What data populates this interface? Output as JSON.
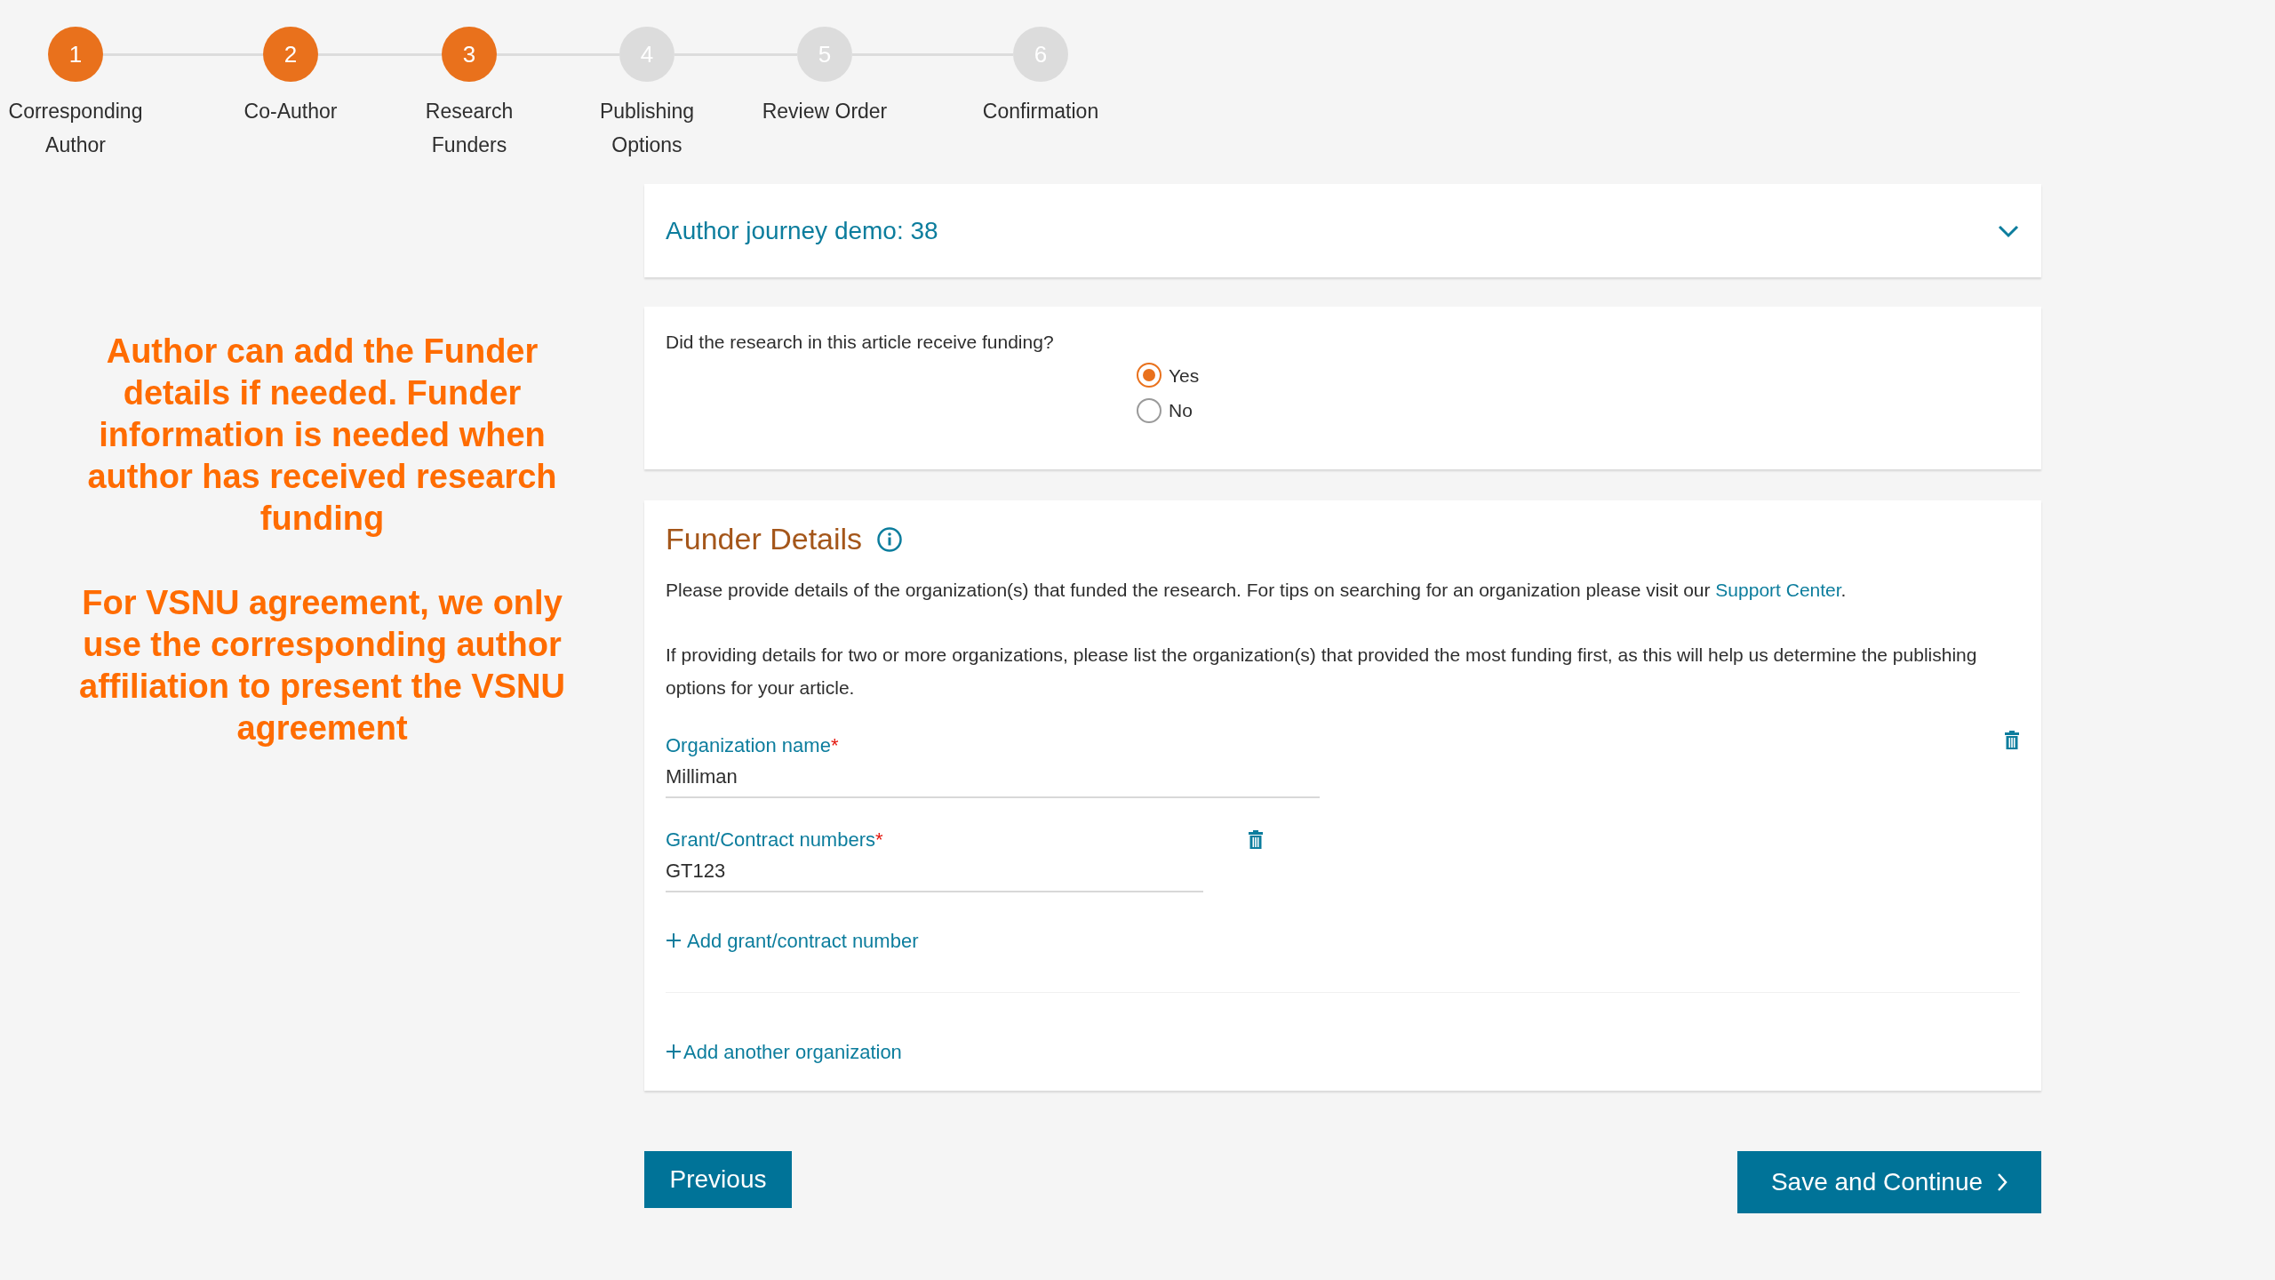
{
  "stepper": [
    {
      "number": "1",
      "label": "Corresponding Author",
      "active": true
    },
    {
      "number": "2",
      "label": "Co-Author",
      "active": true
    },
    {
      "number": "3",
      "label": "Research Funders",
      "active": true
    },
    {
      "number": "4",
      "label": "Publishing Options",
      "active": false
    },
    {
      "number": "5",
      "label": "Review Order",
      "active": false
    },
    {
      "number": "6",
      "label": "Confirmation",
      "active": false
    }
  ],
  "annotation": [
    "Author can add the Funder details if needed. Funder information is needed when author has received research funding",
    "For VSNU agreement, we only use the corresponding author affiliation to present the VSNU agreement"
  ],
  "journey": {
    "title": "Author journey demo: 38",
    "expanded": false
  },
  "funding_question": {
    "question": "Did the research in this article receive funding?",
    "options": [
      {
        "label": "Yes",
        "selected": true
      },
      {
        "label": "No",
        "selected": false
      }
    ]
  },
  "funder_details": {
    "title": "Funder Details",
    "intro": "Please provide details of the organization(s) that funded the research. For tips on searching for an organization please visit our",
    "intro_link": "Support Center",
    "intro_end": ".",
    "note": "If providing details for two or more organizations, please list the organization(s) that provided the most funding first, as this will help us determine the publishing options for your article.",
    "organization": {
      "label": "Organization name",
      "required_mark": "*",
      "value": "Milliman"
    },
    "grant": {
      "label": "Grant/Contract numbers",
      "required_mark": "*",
      "value": "GT123"
    },
    "add_grant": "Add grant/contract number",
    "add_organization": "Add another organization"
  },
  "buttons": {
    "previous": "Previous",
    "save": "Save and Continue"
  }
}
